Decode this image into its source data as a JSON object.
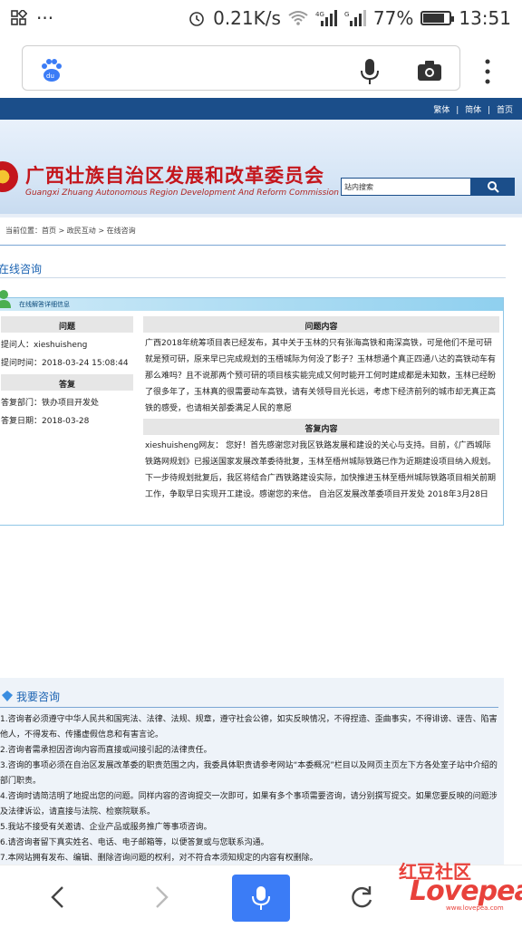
{
  "status_bar": {
    "net_speed": "0.21K/s",
    "battery": "77%",
    "time": "13:51",
    "battery_level": 0.77
  },
  "browser": {
    "top_icons": [
      "baidu-paw-icon",
      "microphone-icon",
      "camera-icon",
      "more-vertical-icon"
    ]
  },
  "site": {
    "top_links": [
      "繁体",
      "简体",
      "首页"
    ],
    "title_cn": "广西壮族自治区发展和改革委员会",
    "title_en": "Guangxi Zhuang Autonomous Region Development And Reform Commission",
    "search_label": "站内搜索",
    "breadcrumb": "当前位置：首页 > 政民互动 > 在线咨询",
    "section_title": "在线咨询",
    "qa_header": "在线解答详细信息",
    "col_question_header": "问题",
    "col_content_header": "问题内容",
    "asker": "提问人：xieshuisheng",
    "ask_time": "提问时间：2018-03-24 15:08:44",
    "reply_header": "答复",
    "reply_dept": "答复部门：铁办项目开发处",
    "reply_date": "答复日期：2018-03-28",
    "question_text": "广西2018年统筹项目表已经发布，其中关于玉林的只有张海高铁和南深高铁，可是他们不是可研就是预可研，原来早已完成规划的玉梧城际为何没了影子？玉林想通个真正四通八达的高铁动车有那么难吗？且不说那两个预可研的项目核实能完成又何时能开工何时建成都是未知数，玉林已经盼了很多年了，玉林真的很需要动车高铁，请有关领导目光长远，考虑下经济前列的城市却无真正高铁的感受，也请相关部委满足人民的意愿",
    "answer_header": "答复内容",
    "answer_text": "xieshuisheng网友：        您好！首先感谢您对我区铁路发展和建设的关心与支持。目前，《广西城际铁路网规划》已报送国家发展改革委待批复，玉林至梧州城际铁路已作为近期建设项目纳入规划。下一步待规划批复后，我区将结合广西铁路建设实际，加快推进玉林至梧州城际铁路项目相关前期工作，争取早日实现开工建设。感谢您的来信。  自治区发展改革委项目开发处 2018年3月28日",
    "consult_title": "我要咨询",
    "rules": [
      "1.咨询者必须遵守中华人民共和国宪法、法律、法规、规章，遵守社会公德，如实反映情况，不得捏造、歪曲事实，不得诽谤、诬告、陷害他人，不得发布、传播虚假信息和有害言论。",
      "2.咨询者需承担因咨询内容而直接或间接引起的法律责任。",
      "3.咨询的事项必须在自治区发展改革委的职责范围之内，我委具体职责请参考网站“本委概况”栏目以及网页主页左下方各处室子站中介绍的部门职责。",
      "4.咨询时请简洁明了地提出您的问题。同样内容的咨询提交一次即可，如果有多个事项需要咨询，请分别撰写提交。如果您要反映的问题涉及法律诉讼，请直接与法院、检察院联系。",
      "5.我站不接受有关邀请、企业产品或服务推广等事项咨询。",
      "6.请咨询者留下真实姓名、电话、电子邮箱等，以便答复或与您联系沟通。",
      "7.本网站拥有发布、编辑、删除咨询问题的权利，对不符合本须知规定的内容有权删除。"
    ]
  },
  "watermark": {
    "top": "红豆社区",
    "brand": "Lovepea",
    "url": "www.lovepea.com"
  }
}
